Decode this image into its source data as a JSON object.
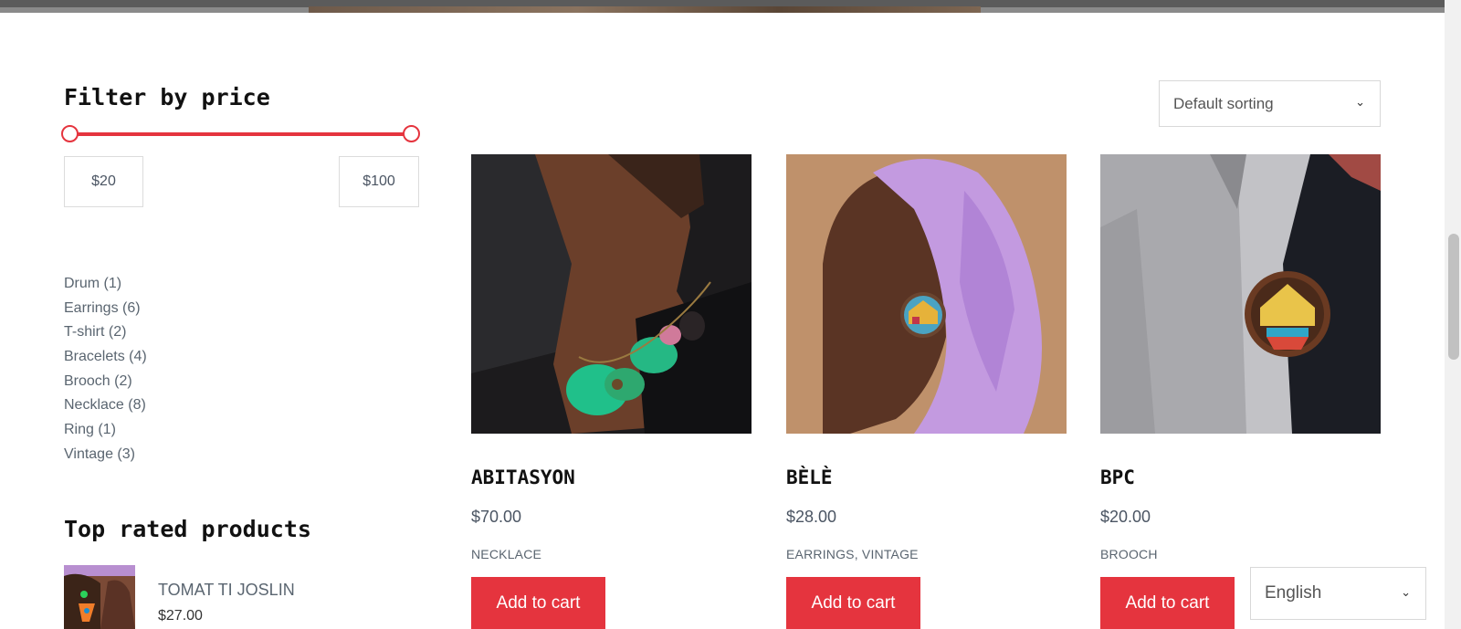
{
  "filter": {
    "title": "Filter by price",
    "min_price": "$20",
    "max_price": "$100"
  },
  "categories": [
    {
      "label": "Drum (1)"
    },
    {
      "label": "Earrings (6)"
    },
    {
      "label": "T-shirt (2)"
    },
    {
      "label": "Bracelets (4)"
    },
    {
      "label": "Brooch (2)"
    },
    {
      "label": "Necklace (8)"
    },
    {
      "label": "Ring (1)"
    },
    {
      "label": "Vintage (3)"
    }
  ],
  "top_rated": {
    "title": "Top rated products",
    "items": [
      {
        "name": "TOMAT TI JOSLIN",
        "price": "$27.00"
      }
    ]
  },
  "sorting": {
    "selected": "Default sorting"
  },
  "products": [
    {
      "name": "ABITASYON",
      "price": "$70.00",
      "categories": "NECKLACE",
      "button": "Add to cart"
    },
    {
      "name": "BÈLÈ",
      "price": "$28.00",
      "categories": "EARRINGS, VINTAGE",
      "button": "Add to cart"
    },
    {
      "name": "BPC",
      "price": "$20.00",
      "categories": "BROOCH",
      "button": "Add to cart"
    }
  ],
  "language": {
    "selected": "English"
  },
  "colors": {
    "accent": "#e5343e",
    "heading": "#111111",
    "text": "#4b5563"
  }
}
